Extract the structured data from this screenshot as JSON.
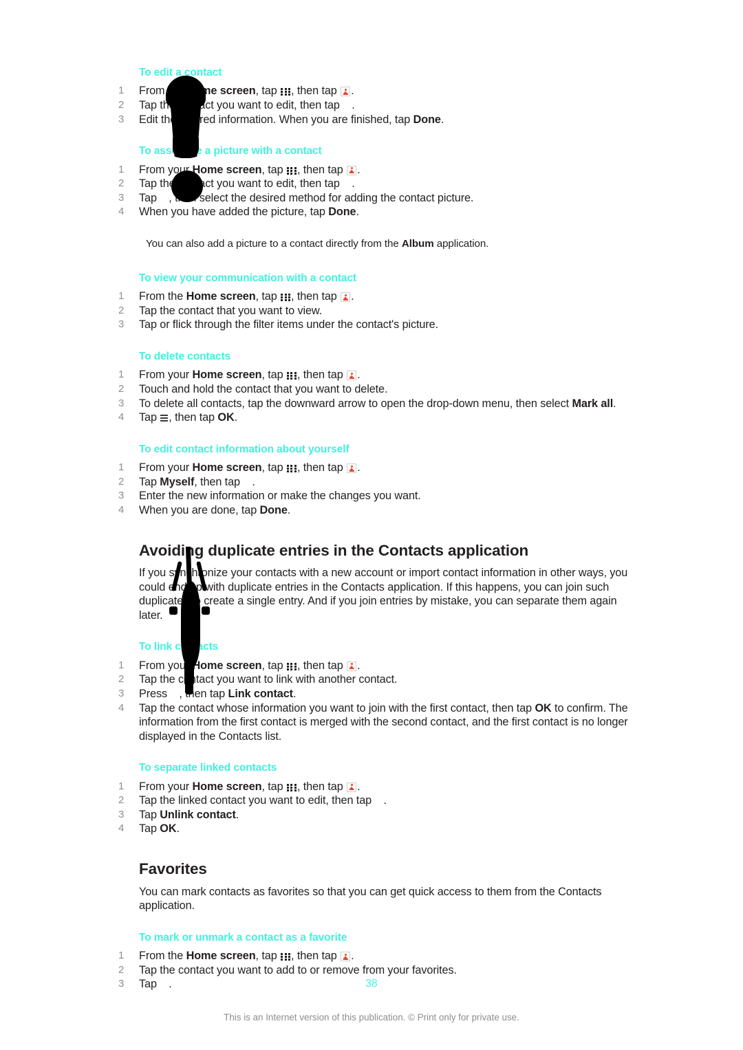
{
  "document": {
    "page_number": "38",
    "footnote": "This is an Internet version of this publication. © Print only for private use.",
    "heading_color": "#41f2dd",
    "body_color": "#231f20",
    "step_number_color": "#8d8d8d"
  },
  "icons": {
    "app_grid": "app-grid-icon",
    "contacts": "contacts-icon",
    "menu": "menu-icon"
  },
  "sections": {
    "edit_contact": {
      "heading": "To edit a contact",
      "steps": {
        "1": {
          "num": "1",
          "a": "From the ",
          "b1": "Home screen",
          "c": ", tap ",
          "d": ", then tap ",
          "e": "."
        },
        "2": {
          "num": "2",
          "a": "Tap the contact you want to edit, then tap ",
          "e": "."
        },
        "3": {
          "num": "3",
          "a": "Edit the desired information. When you are finished, tap ",
          "b1": "Done",
          "e": "."
        }
      }
    },
    "associate_picture": {
      "heading": "To associate a picture with a contact",
      "steps": {
        "1": {
          "num": "1",
          "a": "From your ",
          "b1": "Home screen",
          "c": ", tap ",
          "d": ", then tap ",
          "e": "."
        },
        "2": {
          "num": "2",
          "a": "Tap the contact you want to edit, then tap ",
          "e": "."
        },
        "3": {
          "num": "3",
          "a": "Tap ",
          "d": ", then select the desired method for adding the contact picture.",
          "e": ""
        },
        "4": {
          "num": "4",
          "a": "When you have added the picture, tap ",
          "b1": "Done",
          "e": "."
        }
      },
      "tip": {
        "a": "You can also add a picture to a contact directly from the ",
        "b1": "Album",
        "c": " application."
      }
    },
    "view_communication": {
      "heading": "To view your communication with a contact",
      "steps": {
        "1": {
          "num": "1",
          "a": "From the ",
          "b1": "Home screen",
          "c": ", tap ",
          "d": ", then tap ",
          "e": "."
        },
        "2": {
          "num": "2",
          "a": "Tap the contact that you want to view.",
          "e": ""
        },
        "3": {
          "num": "3",
          "a": "Tap or flick through the filter items under the contact's picture.",
          "e": ""
        }
      }
    },
    "delete_contacts": {
      "heading": "To delete contacts",
      "steps": {
        "1": {
          "num": "1",
          "a": "From your ",
          "b1": "Home screen",
          "c": ", tap ",
          "d": ", then tap ",
          "e": "."
        },
        "2": {
          "num": "2",
          "a": "Touch and hold the contact that you want to delete.",
          "e": ""
        },
        "3": {
          "num": "3",
          "a": "To delete all contacts, tap the downward arrow to open the drop-down menu, then select ",
          "b1": "Mark all",
          "e": "."
        },
        "4": {
          "num": "4",
          "a": "Tap ",
          "c": ", then tap ",
          "b1": "OK",
          "e": "."
        }
      }
    },
    "edit_own_info": {
      "heading": "To edit contact information about yourself",
      "steps": {
        "1": {
          "num": "1",
          "a": "From your ",
          "b1": "Home screen",
          "c": ", tap ",
          "d": ", then tap ",
          "e": "."
        },
        "2": {
          "num": "2",
          "a": "Tap ",
          "b1": "Myself",
          "c": ", then tap ",
          "e": "."
        },
        "3": {
          "num": "3",
          "a": "Enter the new information or make the changes you want.",
          "e": ""
        },
        "4": {
          "num": "4",
          "a": "When you are done, tap ",
          "b1": "Done",
          "e": "."
        }
      }
    },
    "avoiding_duplicates": {
      "heading": "Avoiding duplicate entries in the Contacts application",
      "body": "If you synchronize your contacts with a new account or import contact information in other ways, you could end up with duplicate entries in the Contacts application. If this happens, you can join such duplicates to create a single entry. And if you join entries by mistake, you can separate them again later."
    },
    "link_contacts": {
      "heading": "To link contacts",
      "steps": {
        "1": {
          "num": "1",
          "a": "From your ",
          "b1": "Home screen",
          "c": ", tap ",
          "d": ", then tap ",
          "e": "."
        },
        "2": {
          "num": "2",
          "a": "Tap the contact you want to link with another contact.",
          "e": ""
        },
        "3": {
          "num": "3",
          "a": "Press ",
          "c": ", then tap ",
          "b1": "Link contact",
          "e": "."
        },
        "4": {
          "num": "4",
          "a": "Tap the contact whose information you want to join with the first contact, then tap ",
          "b1": "OK",
          "c": " to confirm. The information from the first contact is merged with the second contact, and the first contact is no longer displayed in the Contacts list.",
          "e": ""
        }
      }
    },
    "separate_linked": {
      "heading": "To separate linked contacts",
      "steps": {
        "1": {
          "num": "1",
          "a": "From your ",
          "b1": "Home screen",
          "c": ", tap ",
          "d": ", then tap ",
          "e": "."
        },
        "2": {
          "num": "2",
          "a": "Tap the linked contact you want to edit, then tap ",
          "e": "."
        },
        "3": {
          "num": "3",
          "a": "Tap ",
          "b1": "Unlink contact",
          "e": "."
        },
        "4": {
          "num": "4",
          "a": "Tap ",
          "b1": "OK",
          "e": "."
        }
      }
    },
    "favorites": {
      "heading": "Favorites",
      "body": "You can mark contacts as favorites so that you can get quick access to them from the Contacts application."
    },
    "mark_favorite": {
      "heading": "To mark or unmark a contact as a favorite",
      "steps": {
        "1": {
          "num": "1",
          "a": "From the ",
          "b1": "Home screen",
          "c": ", tap ",
          "d": ", then tap ",
          "e": "."
        },
        "2": {
          "num": "2",
          "a": "Tap the contact you want to add to or remove from your favorites.",
          "e": ""
        },
        "3": {
          "num": "3",
          "a": "Tap ",
          "e": "."
        }
      }
    }
  }
}
